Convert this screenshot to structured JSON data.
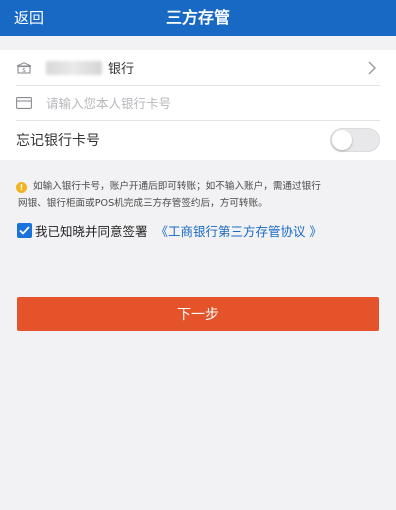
{
  "header": {
    "back_label": "返回",
    "title": "三方存管"
  },
  "form": {
    "bank_name_suffix": "银行",
    "card_placeholder": "请输入您本人银行卡号",
    "forget_label": "忘记银行卡号",
    "forget_toggle_on": false
  },
  "notice": {
    "line1": "如输入银行卡号，账户开通后即可转账；如不输入账户，需通过银行",
    "line2": "网银、银行柜面或POS机完成三方存管签约后，方可转账。"
  },
  "agreement": {
    "checked": true,
    "text": "我已知晓并同意签署",
    "link": "《工商银行第三方存管协议 》"
  },
  "next_button": "下一步",
  "colors": {
    "nav": "#1769c4",
    "button": "#e4532a",
    "link": "#1769c4",
    "warning": "#f0b321"
  }
}
